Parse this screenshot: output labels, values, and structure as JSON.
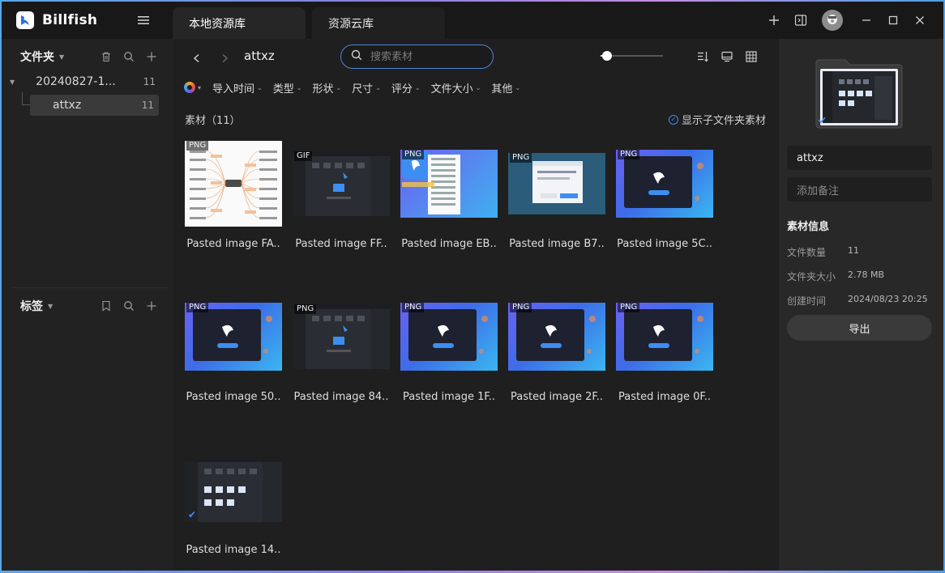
{
  "app": {
    "name": "Billfish",
    "tabs": [
      {
        "label": "本地资源库",
        "active": true
      },
      {
        "label": "资源云库",
        "active": false
      }
    ]
  },
  "sidebar": {
    "folders_header": "文件夹",
    "folders": [
      {
        "label": "20240827-1...",
        "count": "11",
        "expanded": true
      },
      {
        "label": "attxz",
        "count": "11",
        "selected": true
      }
    ],
    "tags_header": "标签"
  },
  "toolbar": {
    "breadcrumb": "attxz",
    "search_placeholder": "搜索素材",
    "zoom_level": 0.1,
    "filters": [
      "导入时间",
      "类型",
      "形状",
      "尺寸",
      "评分",
      "文件大小",
      "其他"
    ]
  },
  "content": {
    "count_label": "素材（11）",
    "show_subfolder_label": "显示子文件夹素材",
    "items": [
      {
        "name": "Pasted image FA..",
        "format": "PNG",
        "skin": "mind"
      },
      {
        "name": "Pasted image FF..",
        "format": "GIF",
        "skin": "dark"
      },
      {
        "name": "Pasted image EB..",
        "format": "PNG",
        "skin": "menu"
      },
      {
        "name": "Pasted image B7..",
        "format": "PNG",
        "skin": "teal"
      },
      {
        "name": "Pasted image 5C..",
        "format": "PNG",
        "skin": "blue"
      },
      {
        "name": "Pasted image 50..",
        "format": "PNG",
        "skin": "blue"
      },
      {
        "name": "Pasted image 84..",
        "format": "PNG",
        "skin": "dark"
      },
      {
        "name": "Pasted image 1F..",
        "format": "PNG",
        "skin": "blue"
      },
      {
        "name": "Pasted image 2F..",
        "format": "PNG",
        "skin": "blue"
      },
      {
        "name": "Pasted image 0F..",
        "format": "PNG",
        "skin": "blue"
      },
      {
        "name": "Pasted image 14..",
        "format": "",
        "skin": "dark"
      }
    ]
  },
  "right_panel": {
    "folder_name": "attxz",
    "note_placeholder": "添加备注",
    "info_title": "素材信息",
    "info": [
      {
        "key": "文件数量",
        "value": "11"
      },
      {
        "key": "文件夹大小",
        "value": "2.78 MB"
      },
      {
        "key": "创建时间",
        "value": "2024/08/23 20:25"
      }
    ],
    "export_label": "导出"
  },
  "colors": {
    "accent": "#3d8ef0",
    "window_bg": "#1f1f1f",
    "titlebar_bg": "#181818"
  }
}
